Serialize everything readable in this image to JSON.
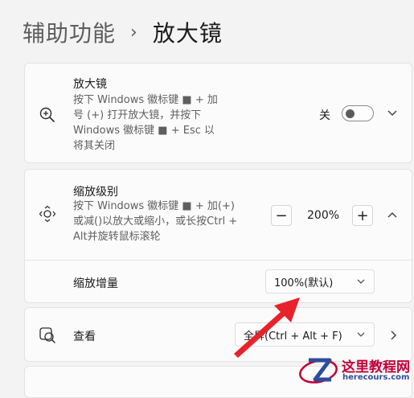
{
  "breadcrumb": {
    "parent": "辅助功能",
    "separator": "›",
    "current": "放大镜"
  },
  "magnifier": {
    "title": "放大镜",
    "description": "按下 Windows 徽标键 ■ + 加\n号 (+) 打开放大镜，并按下\nWindows 徽标键 ■ + Esc 以\n将其关闭",
    "toggle_label": "关",
    "toggle_on": false
  },
  "zoom_level": {
    "title": "缩放级别",
    "description": "按下 Windows 徽标键 ■ + 加(+)\n或减()以放大或缩小，或长按Ctrl +\nAlt并旋转鼠标滚轮",
    "minus_label": "−",
    "value": "200%",
    "plus_label": "+"
  },
  "zoom_increment": {
    "label": "缩放增量",
    "selected": "100%(默认)"
  },
  "view": {
    "label": "查看",
    "selected": "全屏(Ctrl + Alt + F)"
  },
  "watermark": {
    "title": "这里教程网",
    "url": "herecours.com"
  },
  "colors": {
    "arrow": "#e8222b",
    "accent_text": "#1b1b1b",
    "card_bg": "#fbfbfb",
    "page_bg": "#f3f3f3"
  },
  "icons": {
    "magnifier": "zoom-in-icon",
    "zoom_level": "zoom-move-icon",
    "view": "view-mode-icon",
    "expand": "chevron-down-icon",
    "collapse": "chevron-up-icon",
    "navigate": "chevron-right-icon"
  }
}
